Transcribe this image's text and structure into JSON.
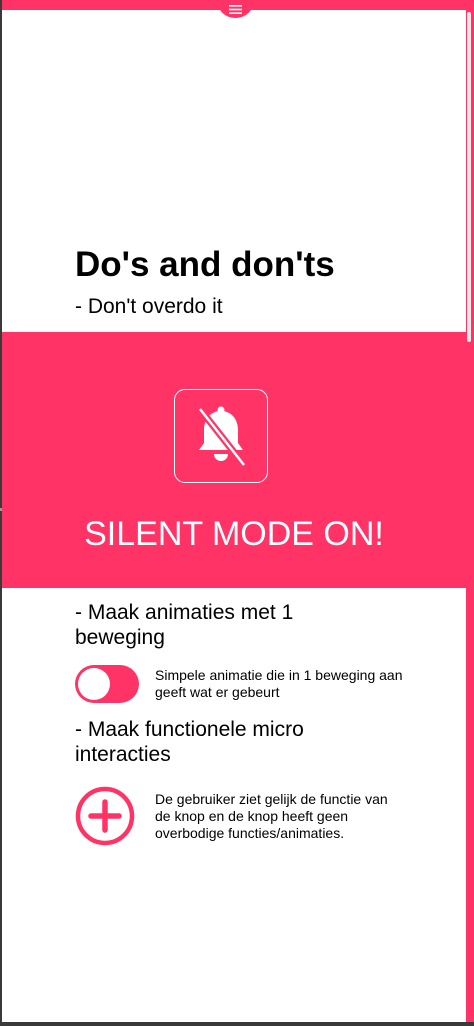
{
  "colors": {
    "accent": "#ff3366",
    "background": "#ffffff",
    "text": "#000000",
    "frame": "#3a3a3a"
  },
  "menu": {
    "icon": "hamburger-menu-icon"
  },
  "section": {
    "title": "Do's and don'ts",
    "subtitle": "- Don't overdo it"
  },
  "banner": {
    "icon": "bell-off-icon",
    "text": "SILENT MODE ON!"
  },
  "items": [
    {
      "heading": "- Maak animaties met 1 beweging",
      "control": "toggle-switch",
      "toggle_on": true,
      "description": "Simpele animatie die in 1 beweging aan geeft wat er gebeurt"
    },
    {
      "heading": "- Maak functionele micro interacties",
      "control": "plus-circle-button",
      "description": "De gebruiker ziet gelijk de functie van de knop en de knop heeft geen overbodige functies/animaties."
    }
  ]
}
